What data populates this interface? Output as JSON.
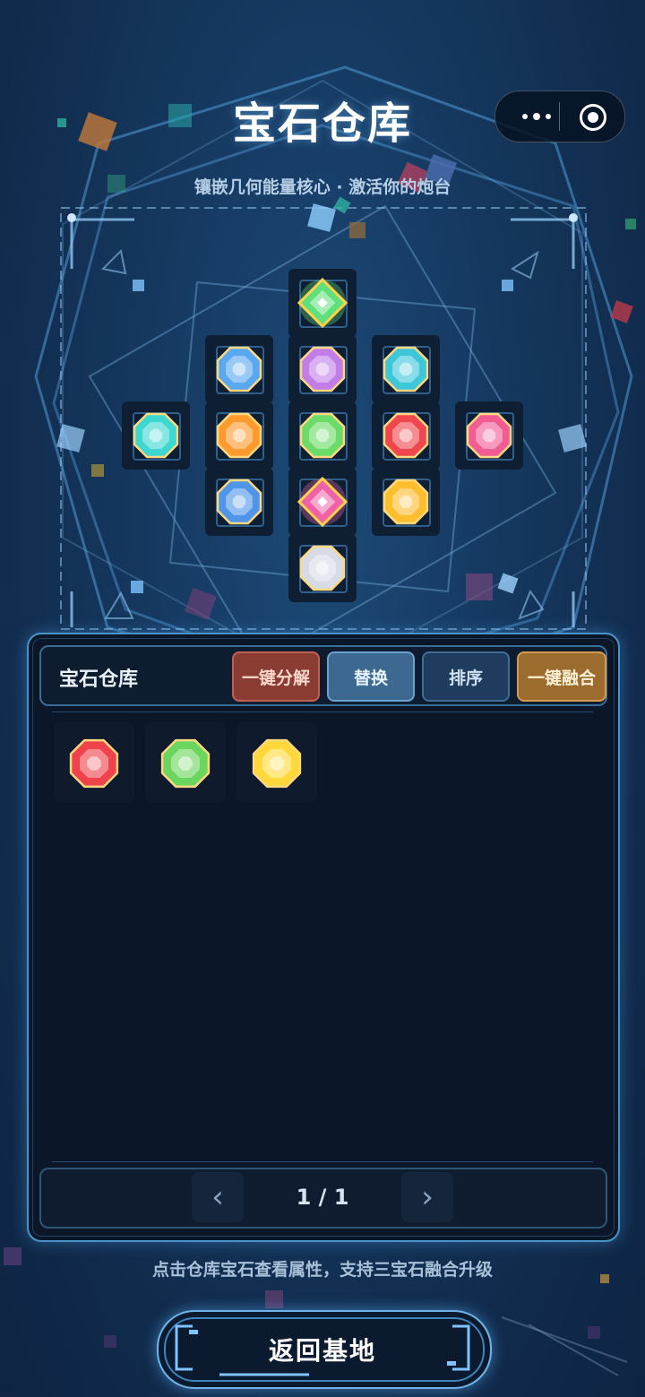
{
  "header": {
    "title": "宝石仓库",
    "subtitle": "镶嵌几何能量核心 · 激活你的炮台"
  },
  "capsule": {
    "more_icon": "more-dots-icon",
    "close_icon": "target-circle-icon"
  },
  "socket_grid": [
    {
      "slot": "top",
      "gem": "diamond",
      "color": "#5fe07a"
    },
    {
      "slot": "row2-left",
      "gem": "octagon",
      "color": "#5aa9f0"
    },
    {
      "slot": "row2-center",
      "gem": "octagon",
      "color": "#c27de8"
    },
    {
      "slot": "row2-right",
      "gem": "octagon",
      "color": "#3ec7d9"
    },
    {
      "slot": "row3-far-left",
      "gem": "octagon",
      "color": "#3fd8d0"
    },
    {
      "slot": "row3-left",
      "gem": "octagon",
      "color": "#ff9a2e"
    },
    {
      "slot": "row3-center",
      "gem": "octagon",
      "color": "#6bdb69"
    },
    {
      "slot": "row3-right",
      "gem": "octagon",
      "color": "#f0474f"
    },
    {
      "slot": "row3-far-right",
      "gem": "octagon",
      "color": "#f25c94"
    },
    {
      "slot": "row4-left",
      "gem": "octagon",
      "color": "#4f95e8"
    },
    {
      "slot": "row4-center",
      "gem": "diamond",
      "color": "#f062a8"
    },
    {
      "slot": "row4-right",
      "gem": "octagon",
      "color": "#ffbe2e"
    },
    {
      "slot": "bottom",
      "gem": "octagon",
      "color": "#d7dbe6"
    }
  ],
  "inventory": {
    "title": "宝石仓库",
    "buttons": {
      "decompose": "一键分解",
      "replace": "替换",
      "sort": "排序",
      "fuse": "一键融合"
    },
    "items": [
      {
        "gem": "octagon",
        "color": "#f0424c"
      },
      {
        "gem": "octagon",
        "color": "#6bd65e"
      },
      {
        "gem": "octagon",
        "color": "#ffd93a"
      }
    ],
    "pagination": {
      "prev": "‹",
      "page": "1 / 1",
      "next": "›"
    }
  },
  "hint": "点击仓库宝石查看属性，支持三宝石融合升级",
  "back_button": "返回基地"
}
